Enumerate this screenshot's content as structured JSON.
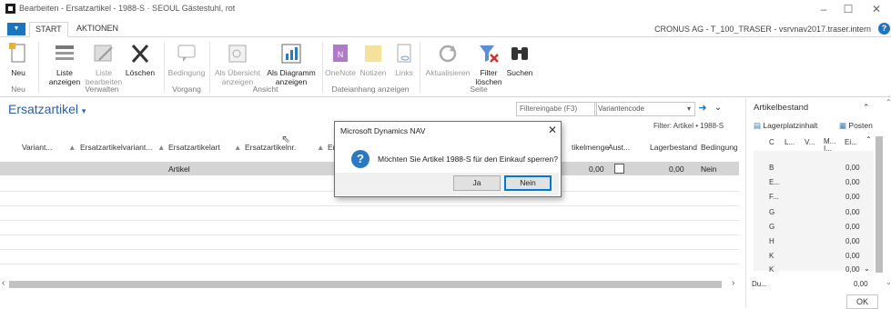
{
  "window": {
    "title": "Bearbeiten - Ersatzartikel - 1988-S · SEOUL Gästestuhl, rot",
    "company": "CRONUS AG - T_100_TRASER - vsrvnav2017.traser.intern"
  },
  "tabs": [
    "START",
    "AKTIONEN"
  ],
  "ribbon": {
    "buttons": {
      "neu": "Neu",
      "liste_anzeigen": [
        "Liste",
        "anzeigen"
      ],
      "liste_bearbeiten": [
        "Liste",
        "bearbeiten"
      ],
      "loeschen": "Löschen",
      "bedingung": "Bedingung",
      "als_uebersicht": [
        "Als Übersicht",
        "anzeigen"
      ],
      "als_diagramm": [
        "Als Diagramm",
        "anzeigen"
      ],
      "onenote": "OneNote",
      "notizen": "Notizen",
      "links": "Links",
      "aktualisieren": "Aktualisieren",
      "filter_loeschen": [
        "Filter",
        "löschen"
      ],
      "suchen": "Suchen"
    },
    "groups": [
      "Neu",
      "Verwalten",
      "Vorgang",
      "Ansicht",
      "Dateianhang anzeigen",
      "Seite"
    ]
  },
  "page": {
    "title": "Ersatzartikel",
    "filter_placeholder": "Filtereingabe (F3)",
    "variant_field": "Variantencode",
    "filter_text": "Filter: Artikel • 1988-S"
  },
  "grid": {
    "columns": [
      "Variant...",
      "Ersatzartikelvariant...",
      "Ersatzartikelart",
      "Ersatzartikelnr.",
      "Er K",
      "tikelmenge",
      "Aust...",
      "Lagerbestand",
      "Bedingung"
    ],
    "row": {
      "ersatzartikelart": "Artikel",
      "artikelmenge": "0,00",
      "lagerbestand": "0,00",
      "bedingung": "Nein"
    }
  },
  "factbox": {
    "title": "Artikelbestand",
    "tabs": [
      "Lagerplatzinhalt",
      "Posten"
    ],
    "columns": [
      "C",
      "L...",
      "V...",
      "M... I...",
      "Ei..."
    ],
    "rows": [
      {
        "label": "B",
        "value": "0,00"
      },
      {
        "label": "E...",
        "value": "0,00"
      },
      {
        "label": "F...",
        "value": "0,00"
      },
      {
        "label": "G",
        "value": "0,00"
      },
      {
        "label": "G",
        "value": "0,00"
      },
      {
        "label": "H",
        "value": "0,00"
      },
      {
        "label": "K",
        "value": "0,00"
      },
      {
        "label": "K",
        "value": "0,00"
      }
    ],
    "footer_label": "Du...",
    "footer_value": "0,00"
  },
  "ok_label": "OK",
  "dialog": {
    "title": "Microsoft Dynamics NAV",
    "message": "Möchten Sie Artikel 1988-S für den Einkauf sperren?",
    "yes": "Ja",
    "no": "Nein"
  }
}
